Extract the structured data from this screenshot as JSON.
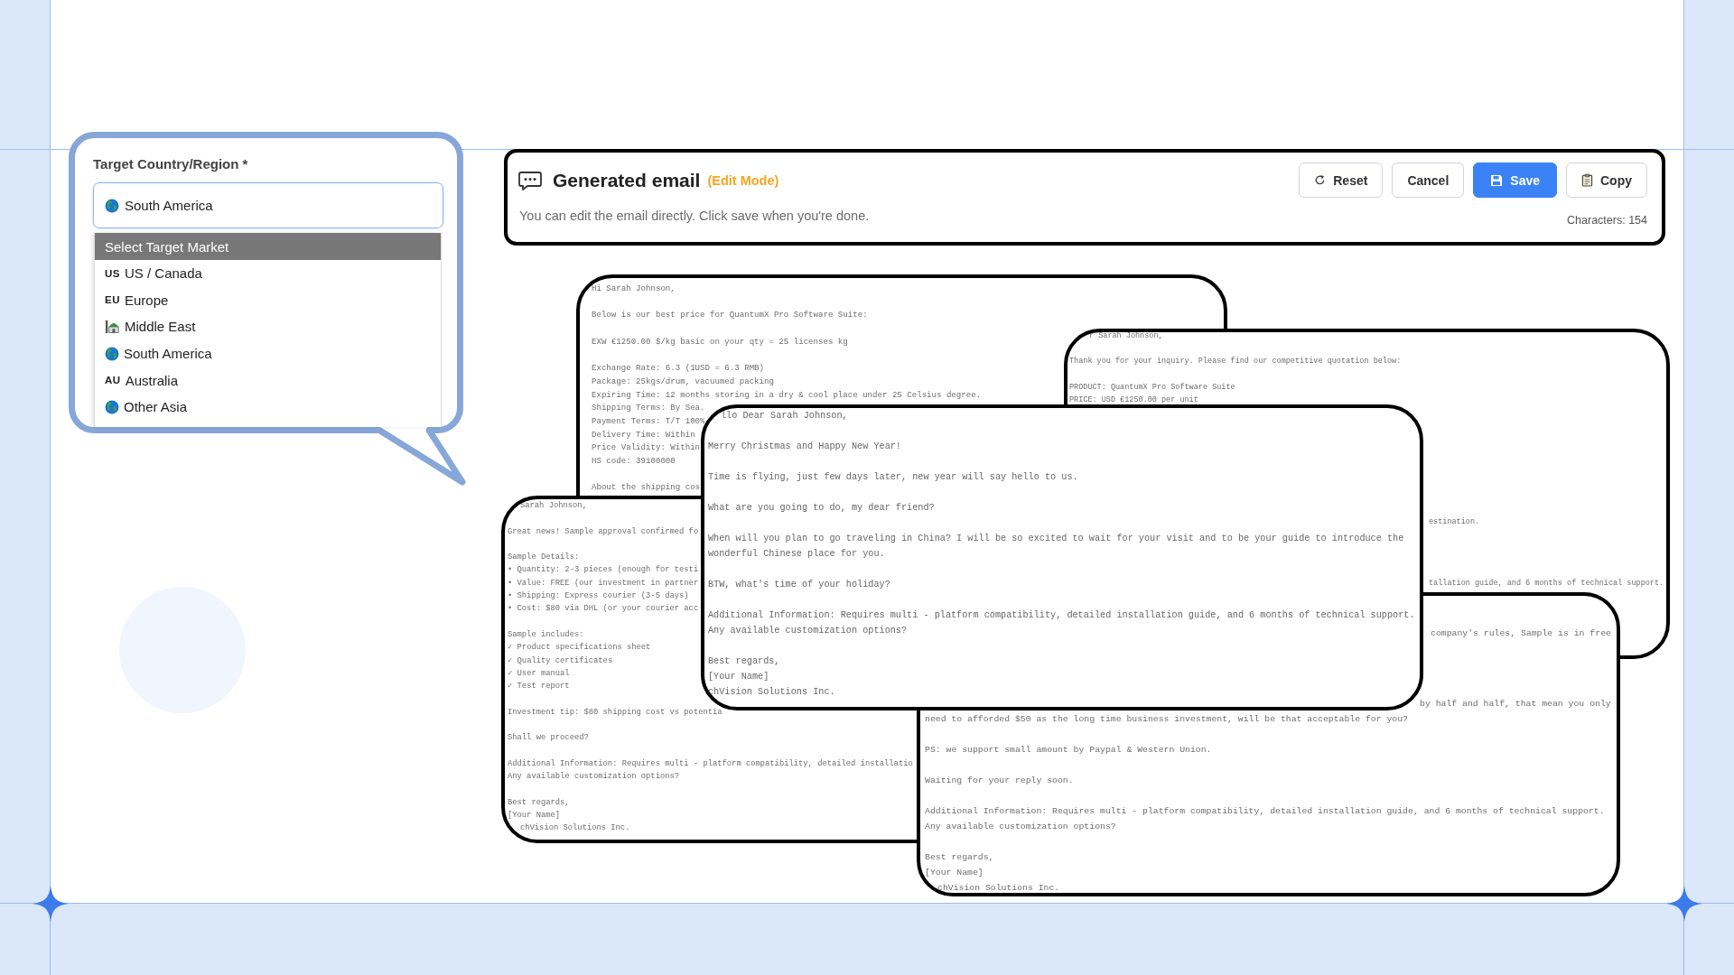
{
  "target_selector": {
    "label": "Target Country/Region *",
    "field": {
      "kind": "globe",
      "value": "South America"
    },
    "options": [
      {
        "kind": "none",
        "label": "Select Target Market",
        "selected": true
      },
      {
        "kind": "code",
        "code": "US",
        "label": "US / Canada",
        "selected": false
      },
      {
        "kind": "code",
        "code": "EU",
        "label": "Europe",
        "selected": false
      },
      {
        "kind": "mosque",
        "label": "Middle East",
        "selected": false
      },
      {
        "kind": "globe",
        "label": "South America",
        "selected": false
      },
      {
        "kind": "code",
        "code": "AU",
        "label": "Australia",
        "selected": false
      },
      {
        "kind": "globe",
        "label": "Other Asia",
        "selected": false
      }
    ]
  },
  "email_panel": {
    "title": "Generated email",
    "mode": "(Edit Mode)",
    "hint": "You can edit the email directly. Click save when you're done.",
    "characters": "Characters: 154",
    "buttons": [
      {
        "kind": "reset",
        "label": "Reset"
      },
      {
        "kind": "cancel",
        "label": "Cancel"
      },
      {
        "kind": "save",
        "label": "Save"
      },
      {
        "kind": "copy",
        "label": "Copy"
      }
    ]
  },
  "email_drafts": [
    {
      "paragraphs": [
        [
          "Hi Sarah Johnson,"
        ],
        [
          "Below is our best price for QuantumX Pro Software Suite:"
        ],
        [
          "EXW €1250.00 $/kg basic on your qty = 25 licenses kg"
        ],
        [
          "Exchange Rate: 6.3 (1USD = 6.3 RMB)",
          "Package: 25kgs/drum, vacuumed packing",
          "Expiring Time: 12 months storing in a dry & cool place under 25 Celsius degree.",
          "Shipping Terms: By Sea.",
          "Payment Terms: T/T 100%",
          "Delivery Time: Within",
          "Price Validity: Within",
          "HS code: 39100000"
        ],
        [
          "About the shipping cos"
        ]
      ]
    },
    {
      "paragraphs": [
        [
          "r Sarah Johnson,"
        ],
        [
          "Thank you for your inquiry. Please find our competitive quotation below:"
        ],
        [
          "PRODUCT: QuantumX Pro Software Suite",
          "PRICE: USD €1250.00 per unit"
        ]
      ],
      "trail_fragments": [
        "estination.",
        "tallation guide, and 6 months of technical support."
      ]
    },
    {
      "paragraphs": [
        [
          "Sarah Johnson,"
        ],
        [
          "Great news! Sample approval confirmed fo"
        ],
        [
          "Sample Details:",
          "• Quantity: 2-3 pieces (enough for testi",
          "• Value: FREE (our investment in partner",
          "• Shipping: Express courier (3-5 days)",
          "• Cost: $80 via DHL (or your courier acc"
        ],
        [
          "Sample includes:",
          "✓ Product specifications sheet",
          "✓ Quality certificates",
          "✓ User manual",
          "✓ Test report"
        ],
        [
          "Investment tip: $80 shipping cost vs potentia"
        ],
        [
          "Shall we proceed?"
        ],
        [
          "Additional Information: Requires multi - platform compatibility, detailed installatio",
          "Any available customization options?"
        ],
        [
          "Best regards,",
          "[Your Name]",
          "chVision Solutions Inc."
        ]
      ]
    },
    {
      "paragraphs": [
        [
          "llo Dear Sarah Johnson,"
        ],
        [
          "Merry Christmas and Happy New Year!"
        ],
        [
          "Time is flying, just few days later, new year will say hello to us."
        ],
        [
          "What are you going to do, my dear friend?"
        ],
        [
          "When will you plan to go traveling in China? I will be so excited to wait for your visit and to be your guide to introduce the",
          "wonderful Chinese place for you."
        ],
        [
          "BTW, what's time of your holiday?"
        ],
        [
          "Additional Information: Requires multi - platform compatibility, detailed installation guide, and 6 months of technical support.",
          "Any available customization options?"
        ],
        [
          "Best regards,",
          "[Your Name]",
          "chVision Solutions Inc."
        ]
      ]
    },
    {
      "lead_fragments": [
        "company's rules, Sample is in free",
        "by half and half, that mean you only"
      ],
      "paragraphs": [
        [
          "need to afforded $50 as the long time business investment, will be that acceptable for you?"
        ],
        [
          "PS: we support small amount by Paypal & Western Union."
        ],
        [
          "Waiting for your reply soon."
        ],
        [
          "Additional Information: Requires multi - platform compatibility, detailed installation guide, and 6 months of technical support.",
          "Any available customization options?"
        ],
        [
          "Best regards,",
          "[Your Name]",
          "chVision Solutions Inc."
        ]
      ]
    }
  ]
}
